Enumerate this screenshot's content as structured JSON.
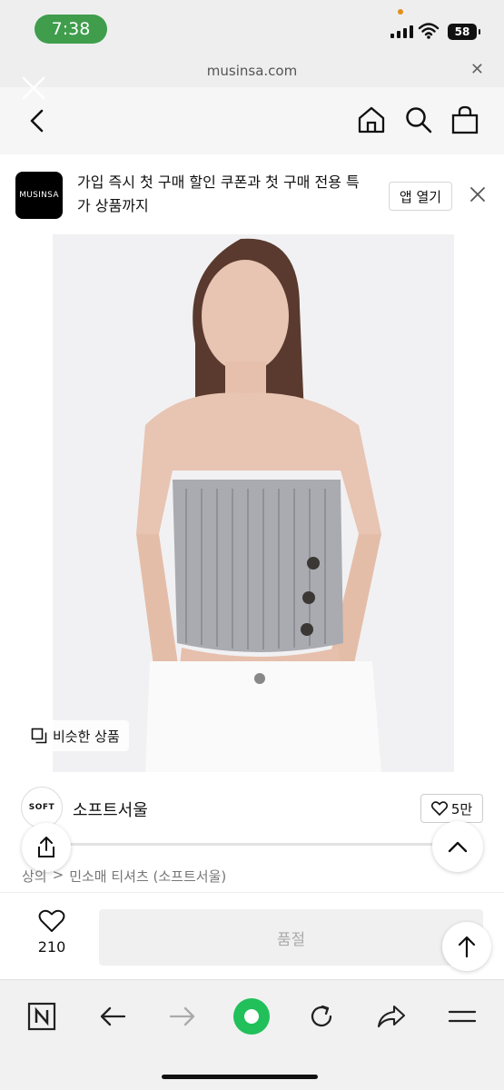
{
  "status": {
    "time": "7:38",
    "battery": "58"
  },
  "urlbar": {
    "url": "musinsa.com",
    "close_icon": "close-icon"
  },
  "banner": {
    "logo_text": "MUSINSA",
    "message": "가입 즉시 첫 구매 할인 쿠폰과 첫 구매 전용 특가 상품까지",
    "open_app_label": "앱 열기"
  },
  "product": {
    "similar_label": "비슷한 상품",
    "brand_logo_text": "SOFT",
    "brand_name": "소프트서울",
    "likes_label": "5만",
    "breadcrumb": [
      "상의",
      ">",
      "민소매 티셔츠 (소프트서울)"
    ]
  },
  "purchase": {
    "wish_count": "210",
    "soldout_label": "품절"
  },
  "colors": {
    "accent_green": "#3f9d4c",
    "browser_home_green": "#21c05a"
  }
}
